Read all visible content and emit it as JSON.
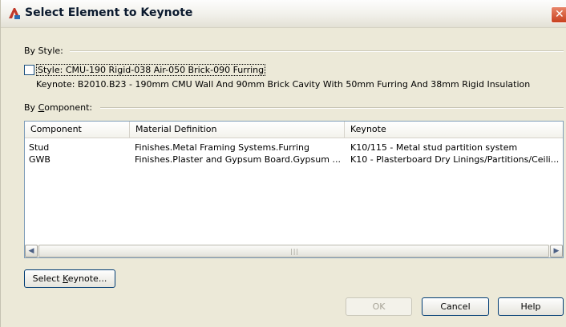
{
  "window": {
    "title": "Select Element to Keynote"
  },
  "by_style": {
    "label": "By Style:",
    "checkbox_label": "Style: CMU-190 Rigid-038 Air-050 Brick-090 Furring",
    "checked": false,
    "keynote_text": "Keynote: B2010.B23 - 190mm CMU Wall And 90mm Brick Cavity With 50mm Furring And 38mm Rigid Insulation"
  },
  "by_component": {
    "label_prefix": "By ",
    "label_accel": "C",
    "label_rest": "omponent:"
  },
  "table": {
    "columns": [
      "Component",
      "Material Definition",
      "Keynote"
    ],
    "rows": [
      [
        "Stud",
        "Finishes.Metal Framing Systems.Furring",
        "K10/115 - Metal stud partition system"
      ],
      [
        "GWB",
        "Finishes.Plaster and Gypsum Board.Gypsum ...",
        "K10 - Plasterboard Dry Linings/Partitions/Ceili..."
      ]
    ]
  },
  "buttons": {
    "select_keynote_prefix": "Select ",
    "select_keynote_accel": "K",
    "select_keynote_rest": "eynote...",
    "ok": "OK",
    "cancel": "Cancel",
    "help": "Help",
    "ok_enabled": false
  },
  "colors": {
    "dialog_bg": "#ece9d8",
    "close_button": "#c8401f",
    "button_border": "#003c74"
  }
}
